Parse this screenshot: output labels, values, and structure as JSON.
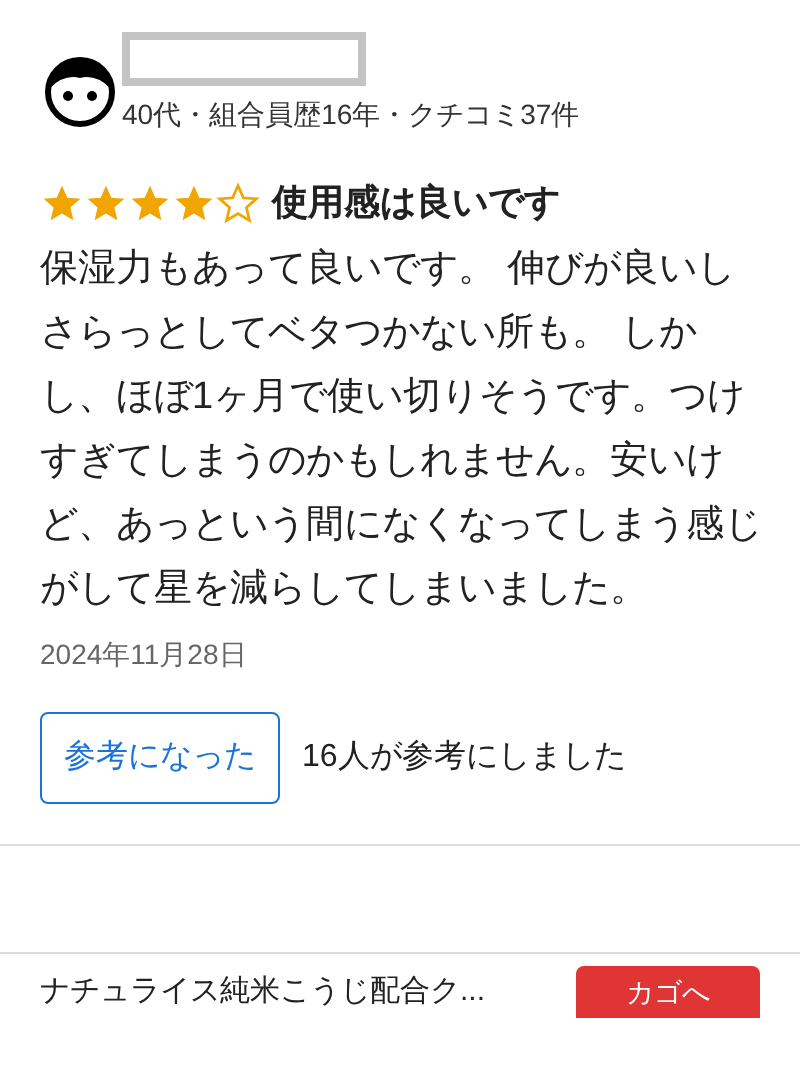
{
  "reviewer": {
    "meta": "40代・組合員歴16年・クチコミ37件"
  },
  "review": {
    "stars": 4,
    "title": "使用感は良いです",
    "body": "保湿力もあって良いです。 伸びが良いしさらっとしてベタつかない所も。 しかし、ほぼ1ヶ月で使い切りそうです。つけすぎてしまうのかもしれません。安いけど、あっという間になくなってしまう感じがして星を減らしてしまいました。",
    "date": "2024年11月28日"
  },
  "helpful": {
    "button": "参考になった",
    "count": "16人が参考にしました"
  },
  "bottom_bar": {
    "product": "ナチュライス純米こうじ配合ク...",
    "cart_button": "カゴへ"
  }
}
